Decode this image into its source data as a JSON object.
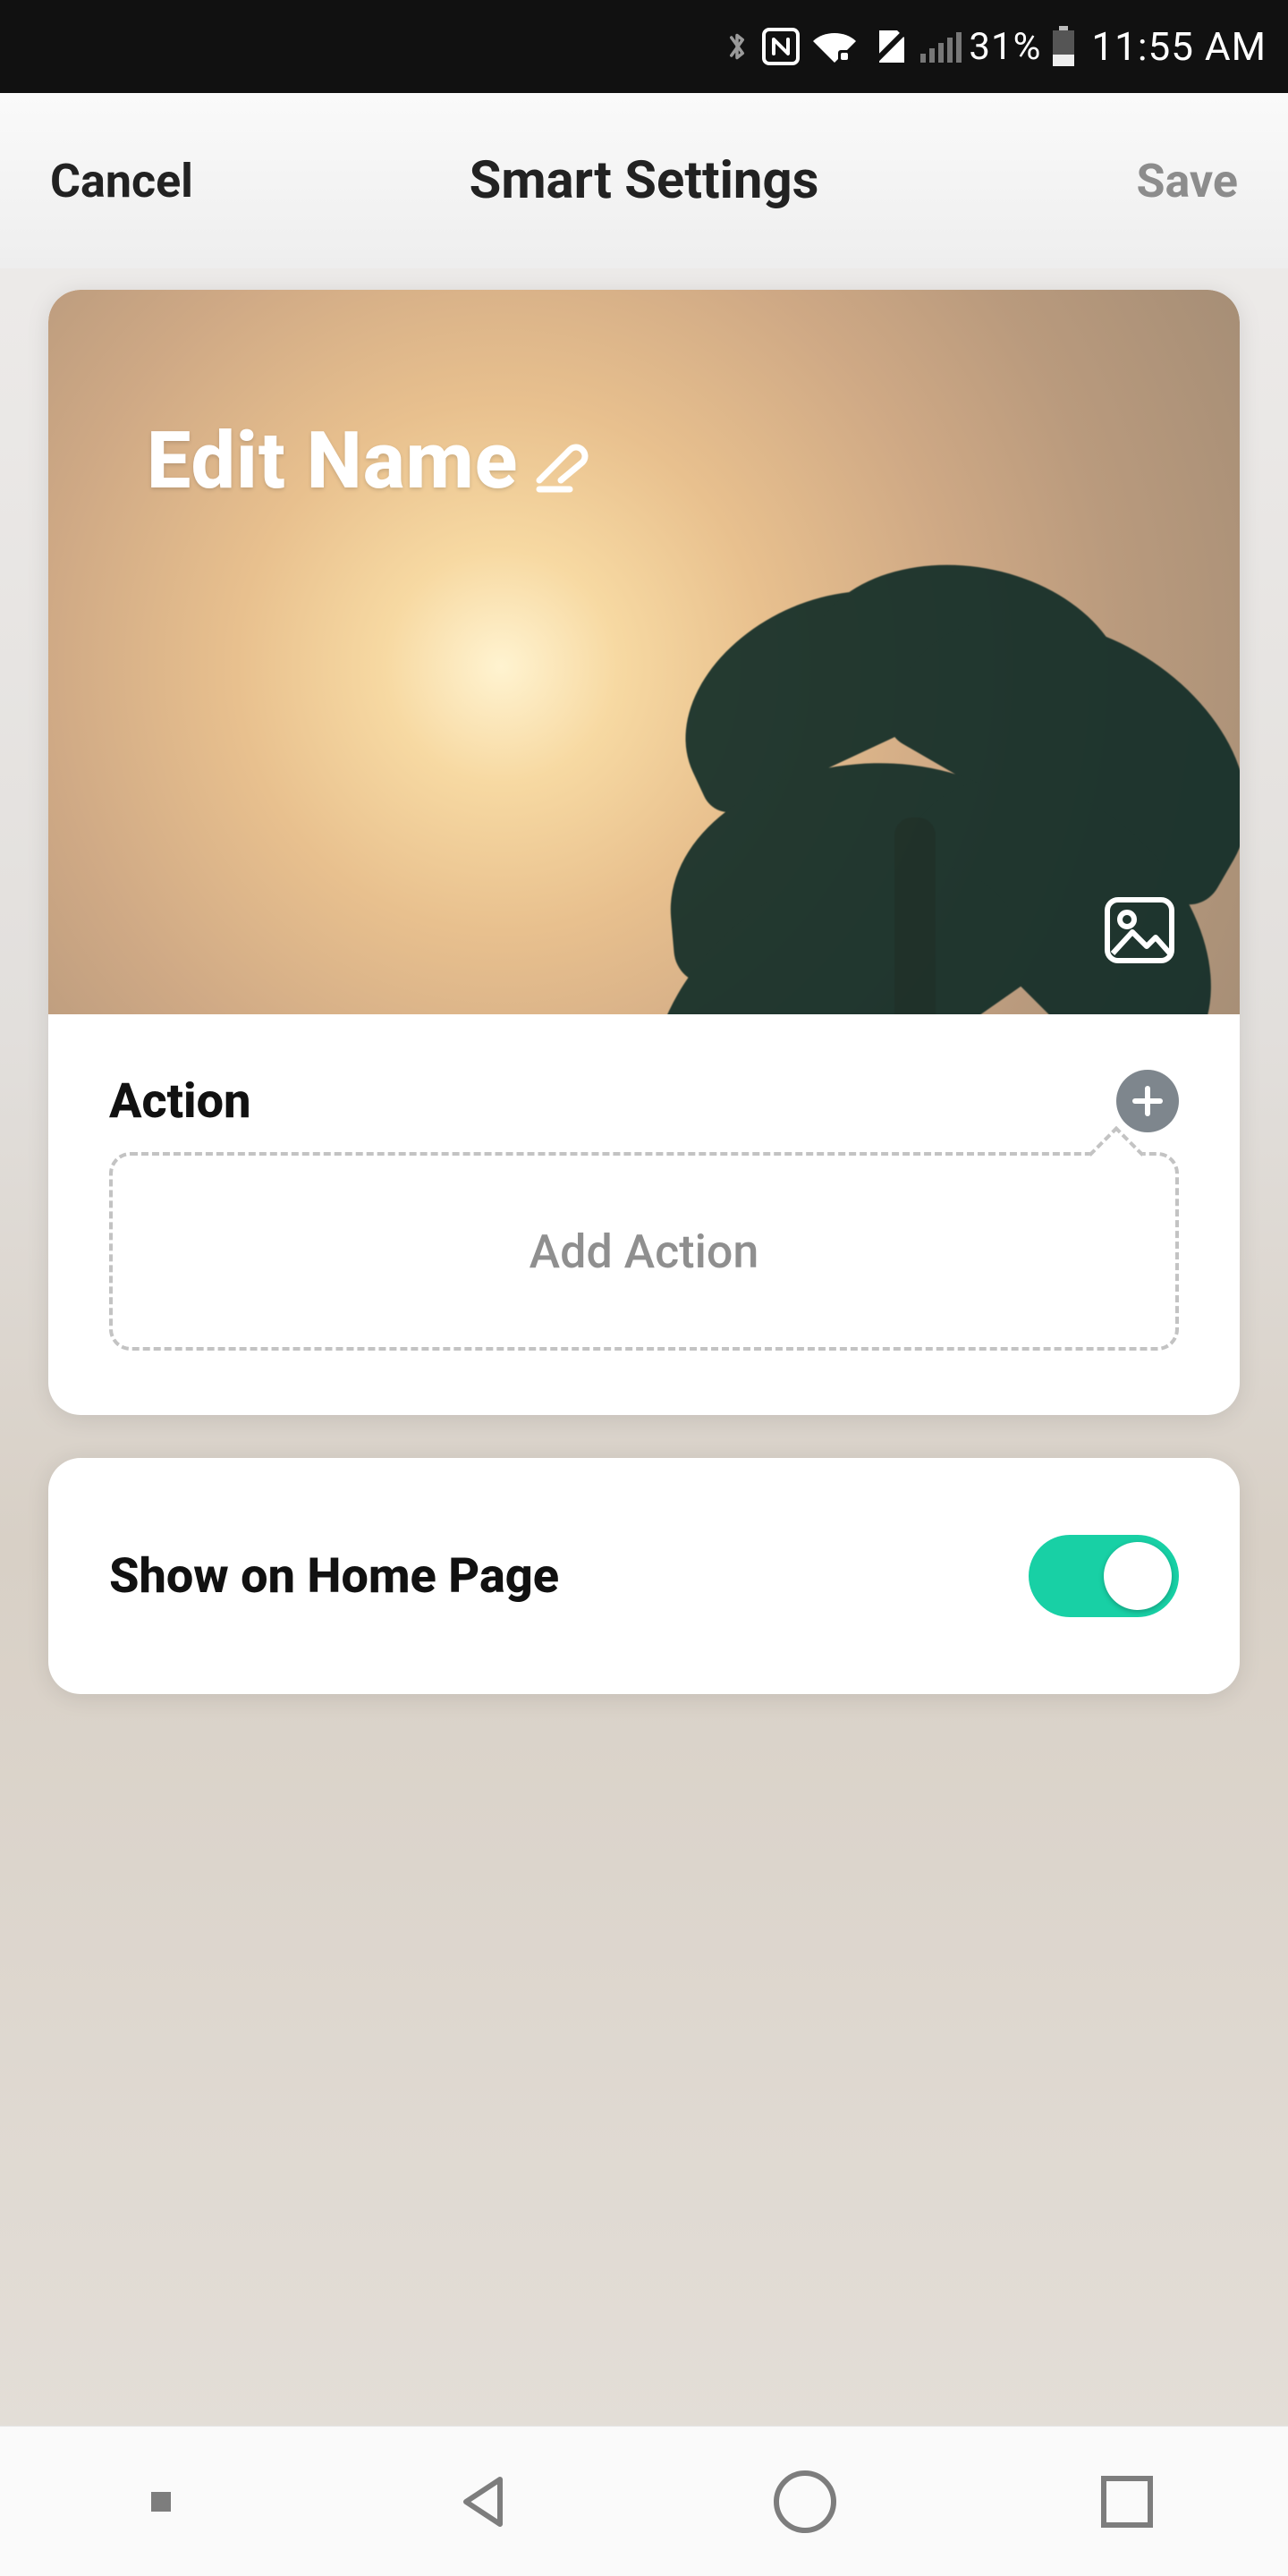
{
  "status": {
    "battery_percent": "31%",
    "time": "11:55 AM"
  },
  "header": {
    "cancel": "Cancel",
    "title": "Smart Settings",
    "save": "Save"
  },
  "hero": {
    "name_placeholder": "Edit Name"
  },
  "action": {
    "section_label": "Action",
    "add_action_label": "Add Action"
  },
  "home_toggle": {
    "label": "Show on Home Page",
    "on": true
  },
  "colors": {
    "accent_teal": "#18d0a5",
    "text_muted": "#8f8f8f",
    "save_disabled": "#8c8c8c"
  },
  "icons": {
    "bluetooth": "bluetooth-icon",
    "nfc": "nfc-icon",
    "wifi": "wifi-icon",
    "no_sim": "no-sim-icon",
    "signal": "signal-icon",
    "battery": "battery-icon",
    "edit": "pencil-icon",
    "image": "image-icon",
    "plus": "plus-icon",
    "nav_back": "back-icon",
    "nav_home": "home-icon",
    "nav_recent": "recent-icon"
  }
}
